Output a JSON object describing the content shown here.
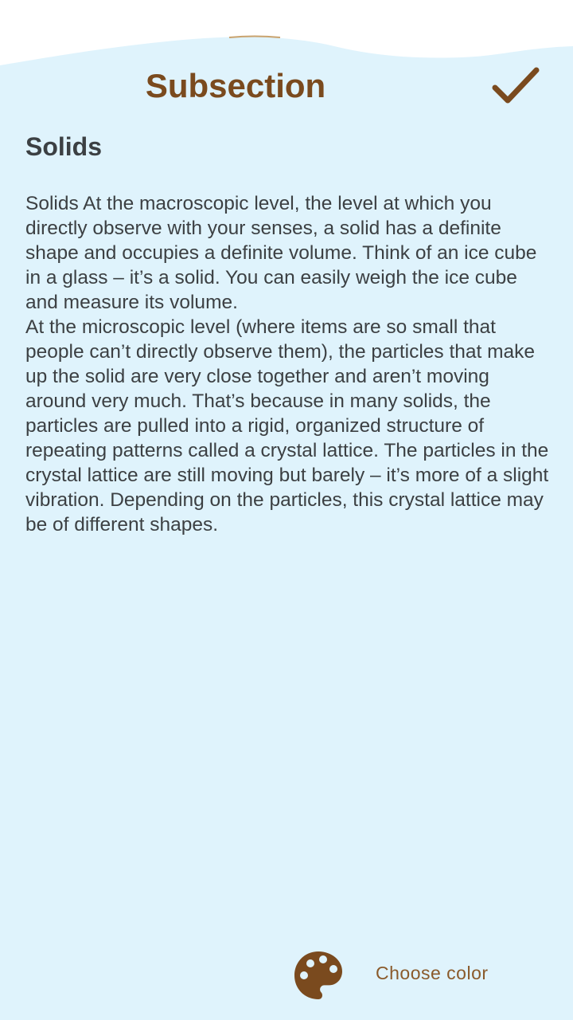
{
  "header": {
    "title": "Subsection"
  },
  "section": {
    "title": "Solids",
    "body": "Solids At the macroscopic level, the level at which you directly observe with your senses, a solid has a definite shape and occupies a definite volume. Think of an ice cube in a glass – it’s a solid. You can easily weigh the ice cube and measure its volume.\nAt the microscopic level (where items are so small that people can’t directly observe them), the particles that make up the solid are very close together and aren’t moving around very much. That’s because in many solids, the particles are pulled into a rigid, organized structure of repeating patterns called a crystal lattice. The particles in the crystal lattice are still moving but barely – it’s more of a slight vibration. Depending on the particles, this crystal lattice may be of different shapes."
  },
  "footer": {
    "choose_color_label": "Choose color",
    "palette_icon": "palette-icon"
  },
  "colors": {
    "background": "#dff3fc",
    "accent": "#7a4a1e",
    "text": "#3c4043"
  }
}
